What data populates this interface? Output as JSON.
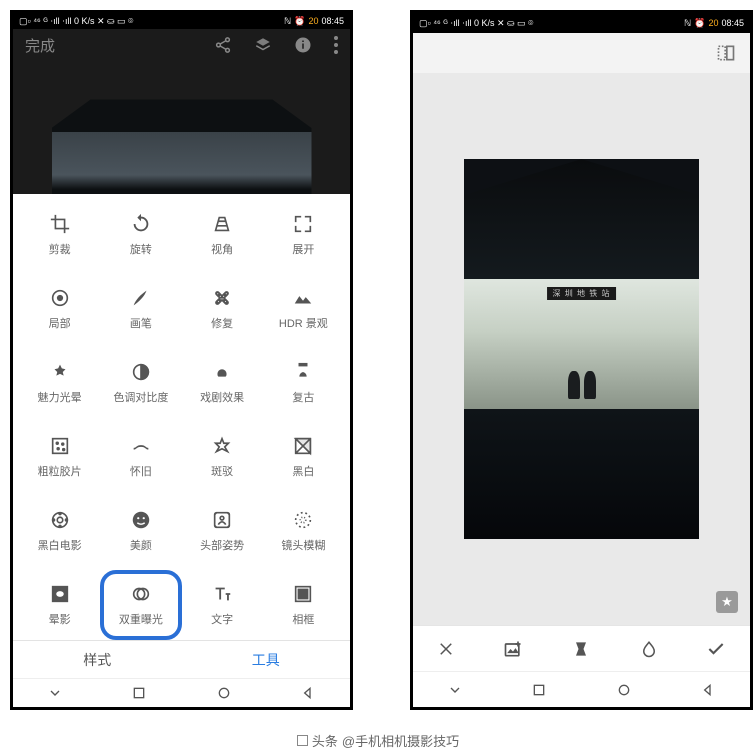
{
  "statusbar": {
    "left": "▢▫ ⁴⁶ ᴳ ⋅ıll ⋅ıll 0 K/s ✕ ⛀ ▭ ⌾",
    "nfc": "ℕ",
    "alarm": "⏰",
    "battery": "20",
    "time": "08:45"
  },
  "left": {
    "done": "完成",
    "tools": [
      {
        "id": "crop",
        "label": "剪裁"
      },
      {
        "id": "rotate",
        "label": "旋转"
      },
      {
        "id": "perspective",
        "label": "视角"
      },
      {
        "id": "expand",
        "label": "展开"
      },
      {
        "id": "selective",
        "label": "局部"
      },
      {
        "id": "brush",
        "label": "画笔"
      },
      {
        "id": "healing",
        "label": "修复"
      },
      {
        "id": "hdr",
        "label": "HDR 景观"
      },
      {
        "id": "glamour",
        "label": "魅力光晕"
      },
      {
        "id": "tonal",
        "label": "色调对比度"
      },
      {
        "id": "drama",
        "label": "戏剧效果"
      },
      {
        "id": "vintage",
        "label": "复古"
      },
      {
        "id": "grainy",
        "label": "粗粒胶片"
      },
      {
        "id": "retrolux",
        "label": "怀旧"
      },
      {
        "id": "grunge",
        "label": "斑驳"
      },
      {
        "id": "bw",
        "label": "黑白"
      },
      {
        "id": "noir",
        "label": "黑白电影"
      },
      {
        "id": "portrait",
        "label": "美颜"
      },
      {
        "id": "headpose",
        "label": "头部姿势"
      },
      {
        "id": "lensblur",
        "label": "镜头模糊"
      },
      {
        "id": "vignette",
        "label": "晕影"
      },
      {
        "id": "double",
        "label": "双重曝光",
        "selected": true
      },
      {
        "id": "text",
        "label": "文字"
      },
      {
        "id": "frame",
        "label": "相框"
      }
    ],
    "tabs": {
      "styles": "样式",
      "tools": "工具"
    }
  },
  "right": {
    "sign_text": "深 圳 地 铁 站"
  },
  "watermark": {
    "prefix": "头条",
    "handle": "@手机相机摄影技巧"
  },
  "iconset": {
    "share": "share-icon",
    "layers": "layers-icon",
    "info": "info-icon",
    "more": "more-icon",
    "compare": "compare-icon",
    "close": "close-icon",
    "addimg": "add-image-icon",
    "blend": "blend-mode-icon",
    "opacity": "opacity-icon",
    "check": "check-icon",
    "chevdown": "chevron-down-icon",
    "square": "square-icon",
    "circle": "circle-icon",
    "back": "back-icon",
    "star": "star-icon"
  }
}
